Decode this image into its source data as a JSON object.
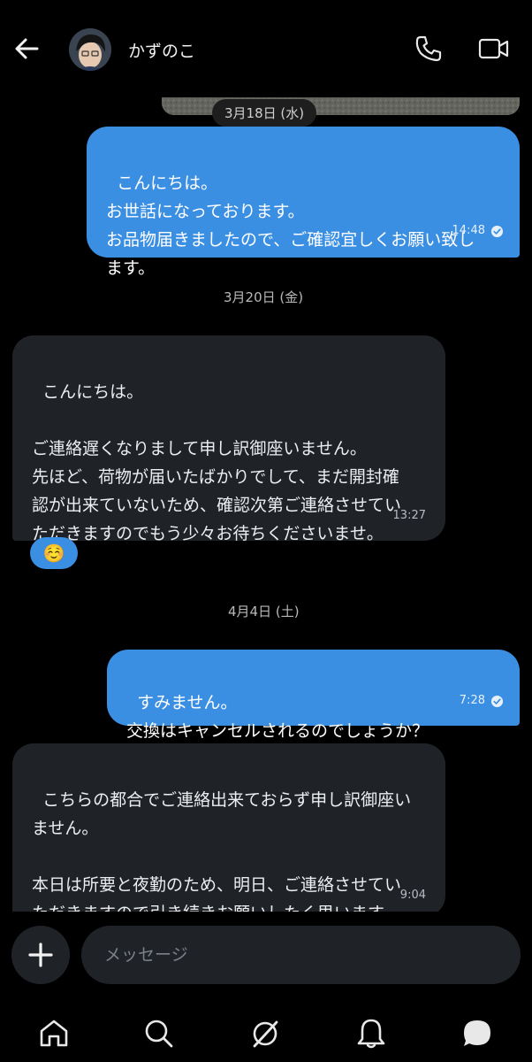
{
  "header": {
    "contact_name": "かずのこ",
    "icons": [
      "back-arrow-icon",
      "phone-icon",
      "video-camera-icon"
    ]
  },
  "messages": [
    {
      "id": "m1",
      "direction": "outgoing",
      "date_chip": "3月18日 (水)",
      "text": "こんにちは。\nお世話になっております。\nお品物届きましたので、ご確認宜しくお願い致し\nます。",
      "time": "14:48",
      "read": true
    },
    {
      "id": "m2",
      "direction": "incoming",
      "date_chip": "3月20日 (金)",
      "text": "こんにちは。\n\nご連絡遅くなりまして申し訳御座いません。\n先ほど、荷物が届いたばかりでして、まだ開封確\n認が出来ていないため、確認次第ご連絡させてい\nただきますのでもう少々お待ちくださいませ。",
      "time": "13:27",
      "reaction": "☺️"
    },
    {
      "id": "m3",
      "direction": "outgoing",
      "date_chip": "4月4日 (土)",
      "text": "すみません。\n交換はキャンセルされるのでしょうか？",
      "time": "7:28",
      "read": true
    },
    {
      "id": "m4",
      "direction": "incoming",
      "text": "こちらの都合でご連絡出来ておらず申し訳御座い\nません。\n\n本日は所要と夜勤のため、明日、ご連絡させてい\nただきますので引き続きお願いしたく思います。",
      "time": "9:04"
    }
  ],
  "composer": {
    "placeholder": "メッセージ",
    "icons": [
      "plus-icon"
    ]
  },
  "tab_bar": {
    "icons": [
      "home-icon",
      "search-icon",
      "grok-icon",
      "notifications-bell-icon",
      "messages-icon"
    ]
  },
  "colors": {
    "background": "#000000",
    "outgoing_bubble": "#3b8fe3",
    "incoming_bubble": "#1f2328",
    "reaction_bubble": "#3b8fe3"
  }
}
